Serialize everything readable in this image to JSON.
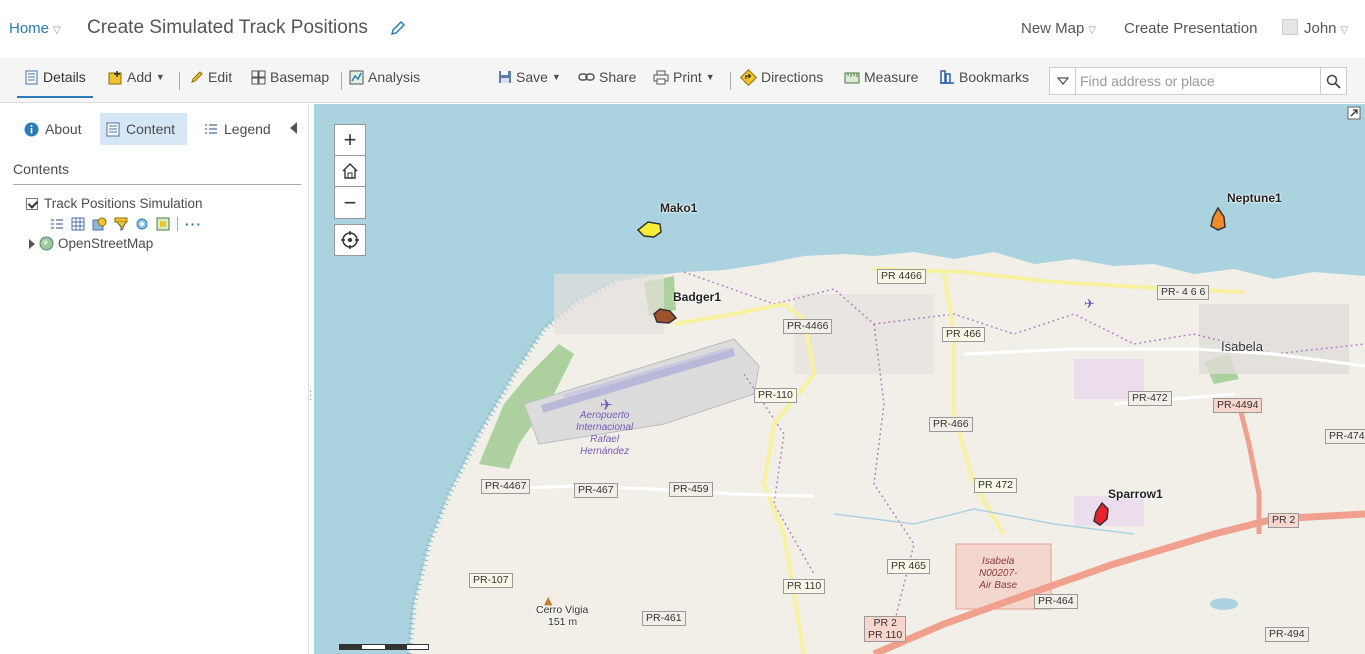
{
  "header": {
    "home_label": "Home",
    "title": "Create Simulated Track Positions",
    "new_map_label": "New Map",
    "create_presentation_label": "Create Presentation",
    "user_name": "John"
  },
  "toolbar": {
    "details": "Details",
    "add": "Add",
    "edit": "Edit",
    "basemap": "Basemap",
    "analysis": "Analysis",
    "save": "Save",
    "share": "Share",
    "print": "Print",
    "directions": "Directions",
    "measure": "Measure",
    "bookmarks": "Bookmarks",
    "search_placeholder": "Find address or place"
  },
  "panel": {
    "tabs": [
      {
        "label": "About"
      },
      {
        "label": "Content",
        "active": true
      },
      {
        "label": "Legend"
      }
    ],
    "contents_heading": "Contents",
    "layers": [
      {
        "name": "Track Positions Simulation",
        "checked": true
      },
      {
        "name": "OpenStreetMap",
        "checked": false
      }
    ],
    "more_icon": "···"
  },
  "map": {
    "zoom_in": "+",
    "zoom_out": "−",
    "tracks": [
      {
        "name": "Mako1",
        "color": "#f5ef3a"
      },
      {
        "name": "Neptune1",
        "color": "#f08a2c"
      },
      {
        "name": "Badger1",
        "color": "#a0522d"
      },
      {
        "name": "Sparrow1",
        "color": "#e8232b"
      }
    ],
    "places": {
      "isabela": "Isabela",
      "cerro_vigia": "Cerro Vigia",
      "cerro_vigia_elev": "151 m",
      "airport": "Aeropuerto Internacional Rafael Hernández",
      "airport_lines": [
        "Aeropuerto",
        "Internacional",
        "Rafael",
        "Hernández"
      ],
      "airbase_lines": [
        "Isabela",
        "N00207-",
        "Air Base"
      ]
    },
    "roads": {
      "pr4466_a": "PR 4466",
      "pr4466_b": "PR-4466",
      "pr4466_c": "PR- 4 6 6",
      "pr466_a": "PR 466",
      "pr466_b": "PR-466",
      "pr110_a": "PR-110",
      "pr110_b": "PR 110",
      "pr472_a": "PR-472",
      "pr472_b": "PR 472",
      "pr4494": "PR-4494",
      "pr4494_v": "PR-4494",
      "pr474": "PR-474",
      "pr4467": "PR-4467",
      "pr467": "PR-467",
      "pr459": "PR-459",
      "pr2": "PR 2",
      "pr2_110_a": "PR 2",
      "pr2_110_b": "PR 110",
      "pr465": "PR 465",
      "pr464": "PR-464",
      "pr107": "PR-107",
      "pr461": "PR-461",
      "pr494": "PR-494"
    }
  }
}
